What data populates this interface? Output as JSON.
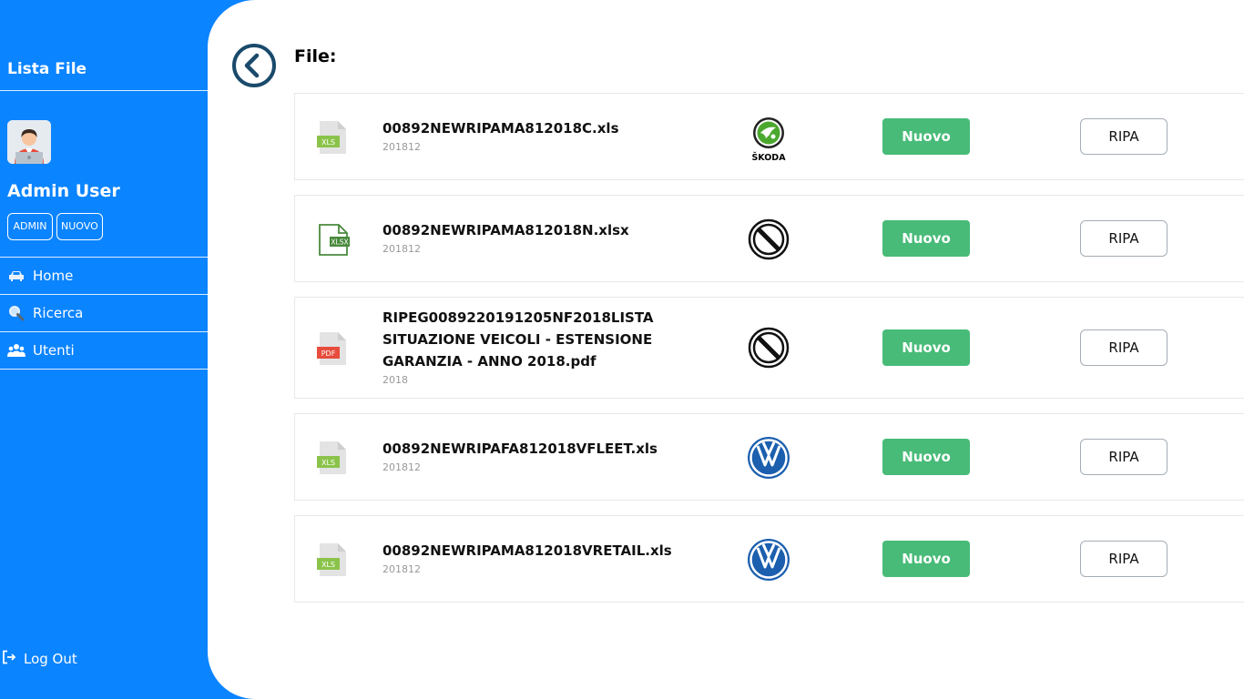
{
  "sidebar": {
    "title": "Lista File",
    "user": {
      "name": "Admin User",
      "badges": [
        "ADMIN",
        "NUOVO"
      ]
    },
    "nav": [
      {
        "label": "Home",
        "icon": "car-icon"
      },
      {
        "label": "Ricerca",
        "icon": "search-icon"
      },
      {
        "label": "Utenti",
        "icon": "users-icon"
      }
    ],
    "logout_label": "Log Out"
  },
  "main": {
    "title": "File:",
    "files": [
      {
        "name": "00892NEWRIPAMA812018C.xls",
        "date": "201812",
        "type_label": "XLS",
        "brand": "ŠKODA",
        "new_label": "Nuovo",
        "ripa_label": "RIPA"
      },
      {
        "name": "00892NEWRIPAMA812018N.xlsx",
        "date": "201812",
        "type_label": "XLSX",
        "brand": "none",
        "new_label": "Nuovo",
        "ripa_label": "RIPA"
      },
      {
        "name": "RIPEG0089220191205NF2018LISTA SITUAZIONE VEICOLI - ESTENSIONE GARANZIA - ANNO 2018.pdf",
        "date": "2018",
        "type_label": "PDF",
        "brand": "none",
        "new_label": "Nuovo",
        "ripa_label": "RIPA"
      },
      {
        "name": "00892NEWRIPAFA812018VFLEET.xls",
        "date": "201812",
        "type_label": "XLS",
        "brand": "volkswagen",
        "new_label": "Nuovo",
        "ripa_label": "RIPA"
      },
      {
        "name": "00892NEWRIPAMA812018VRETAIL.xls",
        "date": "201812",
        "type_label": "XLS",
        "brand": "volkswagen",
        "new_label": "Nuovo",
        "ripa_label": "RIPA"
      }
    ]
  },
  "colors": {
    "sidebar": "#0b84ff",
    "new_button": "#48bb78",
    "back_icon": "#1a4a6b",
    "xls": "#8bc34a",
    "pdf": "#e74c3c",
    "skoda": "#4ba82e",
    "vw": "#1b5fae"
  }
}
